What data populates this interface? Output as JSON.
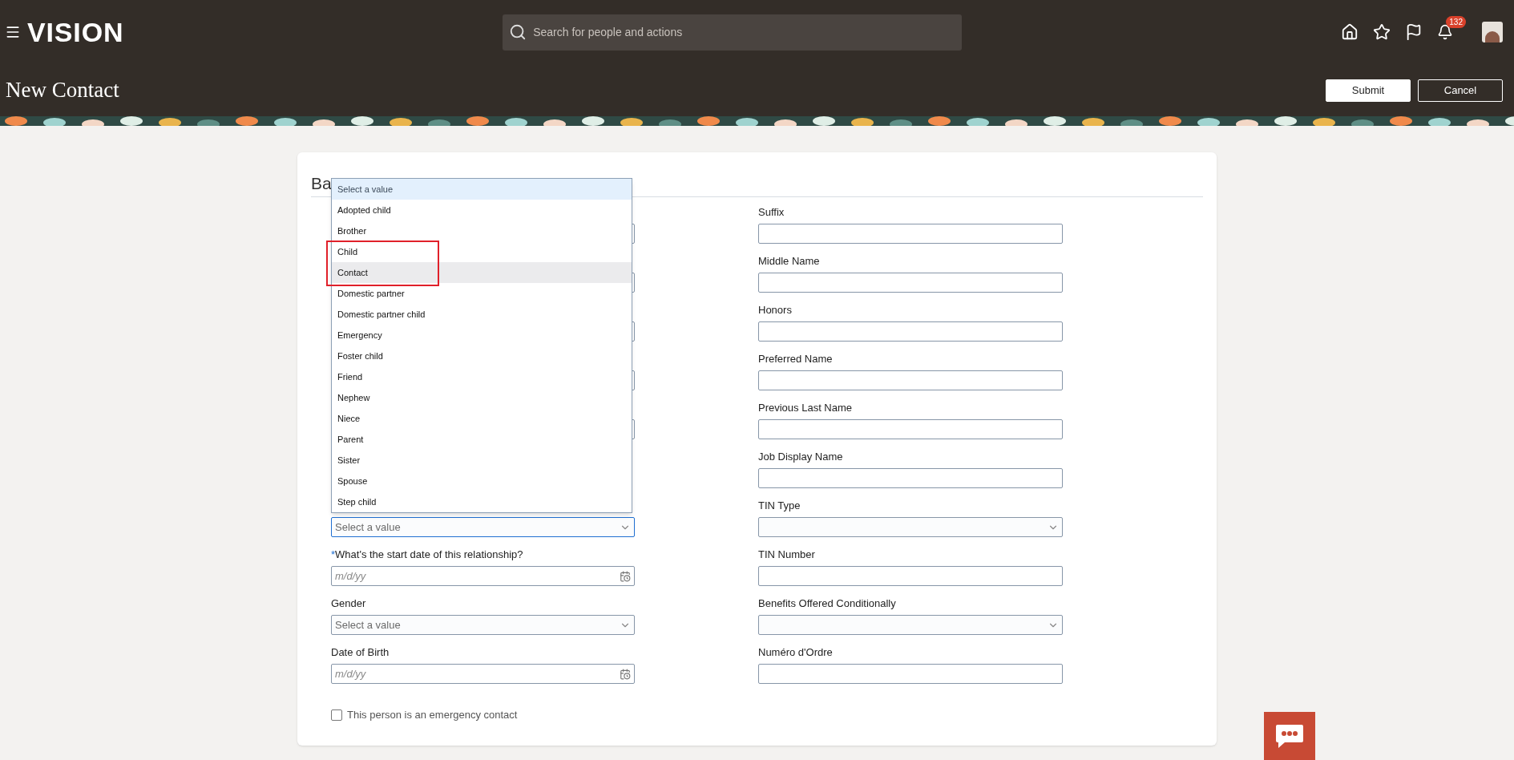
{
  "header": {
    "logo": "VISION",
    "search": {
      "placeholder": "Search for people and actions"
    },
    "notifications_badge": "132"
  },
  "page_title": "New Contact",
  "actions": [
    {
      "label": "Submit",
      "kind": "primary"
    },
    {
      "label": "Cancel",
      "kind": "secondary"
    }
  ],
  "section": {
    "heading": "Ba"
  },
  "left_fields": [
    {
      "kind": "text"
    },
    {
      "kind": "text"
    },
    {
      "kind": "text"
    },
    {
      "kind": "text"
    },
    {
      "kind": "text"
    },
    {
      "kind": "hidden"
    },
    {
      "kind": "select",
      "placeholder": "Select a value",
      "focused": true
    },
    {
      "kind": "date",
      "label": "What's the start date of this relationship?",
      "required_mark": "*",
      "placeholder": "m/d/yy",
      "focused": false
    },
    {
      "kind": "select",
      "label": "Gender",
      "placeholder": "Select a value",
      "focused": false
    },
    {
      "kind": "date",
      "label": "Date of Birth",
      "placeholder": "m/d/yy",
      "focused": false
    }
  ],
  "right_fields": [
    {
      "kind": "text",
      "label": "Suffix"
    },
    {
      "kind": "text",
      "label": "Middle Name"
    },
    {
      "kind": "text",
      "label": "Honors"
    },
    {
      "kind": "text",
      "label": "Preferred Name"
    },
    {
      "kind": "text",
      "label": "Previous Last Name"
    },
    {
      "kind": "text",
      "label": "Job Display Name"
    },
    {
      "kind": "select",
      "label": "TIN Type",
      "focused": false
    },
    {
      "kind": "text",
      "label": "TIN Number"
    },
    {
      "kind": "select",
      "label": "Benefits Offered Conditionally",
      "focused": false
    },
    {
      "kind": "text",
      "label": "Numéro d'Ordre"
    }
  ],
  "checkbox": {
    "label": "This person is an emergency contact",
    "checked": false
  },
  "dropdown": {
    "options": [
      {
        "label": "Select a value",
        "selected": true,
        "highlighted": false
      },
      {
        "label": "Adopted child",
        "selected": false,
        "highlighted": false
      },
      {
        "label": "Brother",
        "selected": false,
        "highlighted": false
      },
      {
        "label": "Child",
        "selected": false,
        "highlighted": false
      },
      {
        "label": "Contact",
        "selected": false,
        "highlighted": true
      },
      {
        "label": "Domestic partner",
        "selected": false,
        "highlighted": false
      },
      {
        "label": "Domestic partner child",
        "selected": false,
        "highlighted": false
      },
      {
        "label": "Emergency",
        "selected": false,
        "highlighted": false
      },
      {
        "label": "Foster child",
        "selected": false,
        "highlighted": false
      },
      {
        "label": "Friend",
        "selected": false,
        "highlighted": false
      },
      {
        "label": "Nephew",
        "selected": false,
        "highlighted": false
      },
      {
        "label": "Niece",
        "selected": false,
        "highlighted": false
      },
      {
        "label": "Parent",
        "selected": false,
        "highlighted": false
      },
      {
        "label": "Sister",
        "selected": false,
        "highlighted": false
      },
      {
        "label": "Spouse",
        "selected": false,
        "highlighted": false
      },
      {
        "label": "Step child",
        "selected": false,
        "highlighted": false
      }
    ]
  }
}
